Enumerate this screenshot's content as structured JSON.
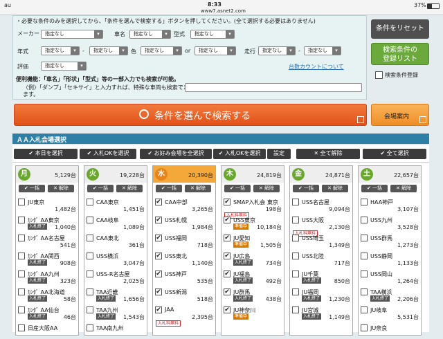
{
  "statusbar": {
    "carrier": "au",
    "time": "8:33",
    "url": "www7.asnet2.com",
    "battery": "37%"
  },
  "search": {
    "notice": "・必要な条件のみを選択してから、「条件を選んで検索する」ボタンを押してください。(全て選択する必要はありません)",
    "maker_label": "メーカー",
    "name_label": "車名",
    "model_label": "型式",
    "year_label": "年式",
    "color_label": "色",
    "or_label": "or",
    "mileage_label": "走行",
    "rating_label": "評価",
    "range_sep": "-",
    "default_option": "指定なし",
    "count_link": "台数カウントについて",
    "tip_title": "便利機能：「車名」「形状」「型式」等の一部入力でも検索が可能。",
    "tip_body1": "〈例〉「ダンプ」「セキサイ」と入力すれば、特殊な車両も検索でき",
    "tip_body2": "ます。",
    "reset_label": "条件をリセット",
    "register_label": "検索条件の登録リスト",
    "register_checkbox_label": "検索条件登録",
    "search_button": "条件を選んで検索する",
    "venue_button": "会場案内"
  },
  "venue": {
    "title": "ＡＡ入札会場選択",
    "toolbar": [
      "本日を選択",
      "入札OKを選択",
      "お好み会場を全選択",
      "入札OKを選択",
      "設定",
      "全て解除",
      "全て選択"
    ],
    "bulk_label": "一括",
    "clear_label": "解除",
    "columns": [
      {
        "day": "月",
        "total": "5,129台",
        "items": [
          {
            "name": "JU東京",
            "tag": "",
            "badge": "",
            "count": "1,482台",
            "checked": false
          },
          {
            "name": "ｶﾝﾀﾞ AA東京",
            "tag": "入札終了",
            "badge": "",
            "count": "1,040台",
            "checked": false
          },
          {
            "name": "ｶﾝﾀﾞ AA名古屋",
            "tag": "",
            "badge": "",
            "count": "541台",
            "checked": false
          },
          {
            "name": "ｶﾝﾀﾞ AA関西",
            "tag": "入札終了",
            "badge": "",
            "count": "908台",
            "checked": false
          },
          {
            "name": "ｶﾝﾀﾞ AA九州",
            "tag": "入札終了",
            "badge": "",
            "count": "323台",
            "checked": false
          },
          {
            "name": "ｶﾝﾀﾞ AA北海道",
            "tag": "入札終了",
            "badge": "",
            "count": "58台",
            "checked": false
          },
          {
            "name": "ｶﾝﾀﾞ AA仙台",
            "tag": "入札終了",
            "badge": "",
            "count": "46台",
            "checked": false
          },
          {
            "name": "日産大阪AA",
            "tag": "",
            "badge": "",
            "count": "",
            "checked": false
          }
        ]
      },
      {
        "day": "火",
        "total": "19,228台",
        "items": [
          {
            "name": "CAA東京",
            "tag": "",
            "badge": "",
            "count": "1,451台",
            "checked": false
          },
          {
            "name": "CAA岐阜",
            "tag": "",
            "badge": "",
            "count": "1,089台",
            "checked": false
          },
          {
            "name": "CAA東北",
            "tag": "",
            "badge": "",
            "count": "361台",
            "checked": false
          },
          {
            "name": "USS横浜",
            "tag": "",
            "badge": "",
            "count": "3,047台",
            "checked": false
          },
          {
            "name": "USS-R名古屋",
            "tag": "",
            "badge": "",
            "count": "2,025台",
            "checked": false
          },
          {
            "name": "TAA近畿",
            "tag": "入札終了",
            "badge": "",
            "count": "1,656台",
            "checked": false
          },
          {
            "name": "TAA九州",
            "tag": "入札終了",
            "badge": "",
            "count": "1,543台",
            "checked": false
          },
          {
            "name": "TAA南九州",
            "tag": "",
            "badge": "",
            "count": "",
            "checked": false
          }
        ]
      },
      {
        "day": "水",
        "total": "20,390台",
        "items": [
          {
            "name": "CAA中部",
            "tag": "",
            "badge": "",
            "count": "3,265台",
            "checked": true
          },
          {
            "name": "USS札幌",
            "tag": "",
            "badge": "",
            "count": "1,984台",
            "checked": true
          },
          {
            "name": "USS福岡",
            "tag": "",
            "badge": "",
            "count": "718台",
            "checked": true
          },
          {
            "name": "USS東北",
            "tag": "",
            "badge": "",
            "count": "1,140台",
            "checked": true
          },
          {
            "name": "USS神戸",
            "tag": "",
            "badge": "",
            "count": "535台",
            "checked": true
          },
          {
            "name": "USS新潟",
            "tag": "",
            "badge": "",
            "count": "518台",
            "checked": true
          },
          {
            "name": "JAA",
            "tag": "",
            "badge": "入札料無料",
            "count": "2,395台",
            "checked": true
          },
          {
            "name": "",
            "tag": "",
            "badge": "",
            "count": "",
            "checked": false
          }
        ]
      },
      {
        "day": "木",
        "total": "24,819台",
        "items": [
          {
            "name": "SMAP入札会 東京",
            "tag": "",
            "badge": "入札料無料",
            "count": "198台",
            "checked": true
          },
          {
            "name": "USS東京",
            "tag": "準備中",
            "badge": "",
            "count": "10,184台",
            "checked": true
          },
          {
            "name": "JU愛知",
            "tag": "準備中",
            "badge": "",
            "count": "1,505台",
            "checked": true
          },
          {
            "name": "JU広島",
            "tag": "入札終了",
            "badge": "",
            "count": "734台",
            "checked": true
          },
          {
            "name": "JU福島",
            "tag": "入札終了",
            "badge": "",
            "count": "492台",
            "checked": true
          },
          {
            "name": "JU群馬",
            "tag": "入札終了",
            "badge": "",
            "count": "438台",
            "checked": true
          },
          {
            "name": "JU神奈川",
            "tag": "準備中",
            "badge": "",
            "count": "",
            "checked": true
          },
          {
            "name": "",
            "tag": "",
            "badge": "",
            "count": "",
            "checked": false
          }
        ]
      },
      {
        "day": "金",
        "total": "24,871台",
        "items": [
          {
            "name": "USS名古屋",
            "tag": "",
            "badge": "",
            "count": "9,094台",
            "checked": false
          },
          {
            "name": "USS大阪",
            "tag": "",
            "badge": "入札料無料",
            "count": "2,130台",
            "checked": false
          },
          {
            "name": "USS埼玉",
            "tag": "",
            "badge": "",
            "count": "1,349台",
            "checked": false
          },
          {
            "name": "USS北陸",
            "tag": "",
            "badge": "",
            "count": "717台",
            "checked": false
          },
          {
            "name": "JU千葉",
            "tag": "入札終了",
            "badge": "",
            "count": "850台",
            "checked": false
          },
          {
            "name": "JU福岡",
            "tag": "入札終了",
            "badge": "",
            "count": "1,230台",
            "checked": false
          },
          {
            "name": "JU宮城",
            "tag": "入札終了",
            "badge": "",
            "count": "1,149台",
            "checked": false
          },
          {
            "name": "",
            "tag": "",
            "badge": "",
            "count": "",
            "checked": false
          }
        ]
      },
      {
        "day": "土",
        "total": "22,657台",
        "items": [
          {
            "name": "HAA神戸",
            "tag": "",
            "badge": "",
            "count": "3,107台",
            "checked": false
          },
          {
            "name": "USS九州",
            "tag": "",
            "badge": "",
            "count": "3,528台",
            "checked": false
          },
          {
            "name": "USS群馬",
            "tag": "",
            "badge": "",
            "count": "1,273台",
            "checked": false
          },
          {
            "name": "USS静岡",
            "tag": "",
            "badge": "",
            "count": "1,133台",
            "checked": false
          },
          {
            "name": "USS岡山",
            "tag": "",
            "badge": "",
            "count": "1,264台",
            "checked": false
          },
          {
            "name": "TAA横浜",
            "tag": "入札終了",
            "badge": "",
            "count": "2,206台",
            "checked": false
          },
          {
            "name": "JU岐阜",
            "tag": "",
            "badge": "",
            "count": "5,531台",
            "checked": false
          },
          {
            "name": "JU奈良",
            "tag": "",
            "badge": "",
            "count": "",
            "checked": false
          }
        ]
      }
    ]
  },
  "colors": {
    "accent": "#2d7fa6",
    "green": "#6aa82d",
    "orange": "#e2511a",
    "wed_highlight": "#f4a83a"
  }
}
